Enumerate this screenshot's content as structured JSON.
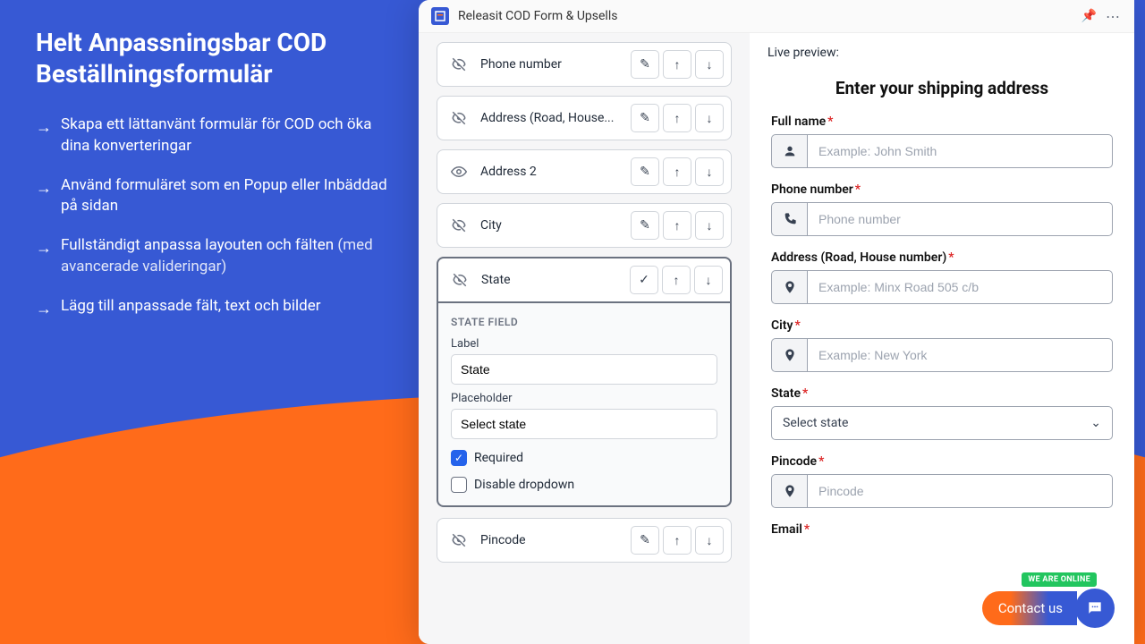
{
  "marketing": {
    "headline": "Helt Anpassningsbar COD Beställningsformulär",
    "features": [
      {
        "bold": "Skapa ett lättanvänt formulär för COD och öka dina konverteringar",
        "dim": ""
      },
      {
        "bold": "Använd formuläret som en Popup eller Inbäddad på sidan",
        "dim": ""
      },
      {
        "bold": "Fullständigt anpassa layouten och fälten",
        "dim": " (med avancerade valideringar)"
      },
      {
        "bold": "Lägg till anpassade fält, text och bilder",
        "dim": ""
      }
    ]
  },
  "app": {
    "title": "Releasit COD Form & Upsells"
  },
  "builder": {
    "fields": [
      {
        "label": "Phone number",
        "hidden": true
      },
      {
        "label": "Address (Road, House...",
        "hidden": true
      },
      {
        "label": "Address 2",
        "hidden": false
      },
      {
        "label": "City",
        "hidden": true
      },
      {
        "label": "State",
        "hidden": true,
        "expanded": true
      },
      {
        "label": "Pincode",
        "hidden": true
      }
    ],
    "details": {
      "section_title": "STATE FIELD",
      "label_caption": "Label",
      "label_value": "State",
      "placeholder_caption": "Placeholder",
      "placeholder_value": "Select state",
      "required_label": "Required",
      "required_checked": true,
      "disable_label": "Disable dropdown",
      "disable_checked": false
    }
  },
  "preview": {
    "title": "Live preview:",
    "heading": "Enter your shipping address",
    "fields": {
      "fullname": {
        "label": "Full name",
        "placeholder": "Example: John Smith"
      },
      "phone": {
        "label": "Phone number",
        "placeholder": "Phone number"
      },
      "address": {
        "label": "Address (Road, House number)",
        "placeholder": "Example: Minx Road 505 c/b"
      },
      "city": {
        "label": "City",
        "placeholder": "Example: New York"
      },
      "state": {
        "label": "State",
        "placeholder": "Select state"
      },
      "pincode": {
        "label": "Pincode",
        "placeholder": "Pincode"
      },
      "email": {
        "label": "Email"
      }
    }
  },
  "contact": {
    "text": "Contact us",
    "badge": "WE ARE ONLINE"
  }
}
